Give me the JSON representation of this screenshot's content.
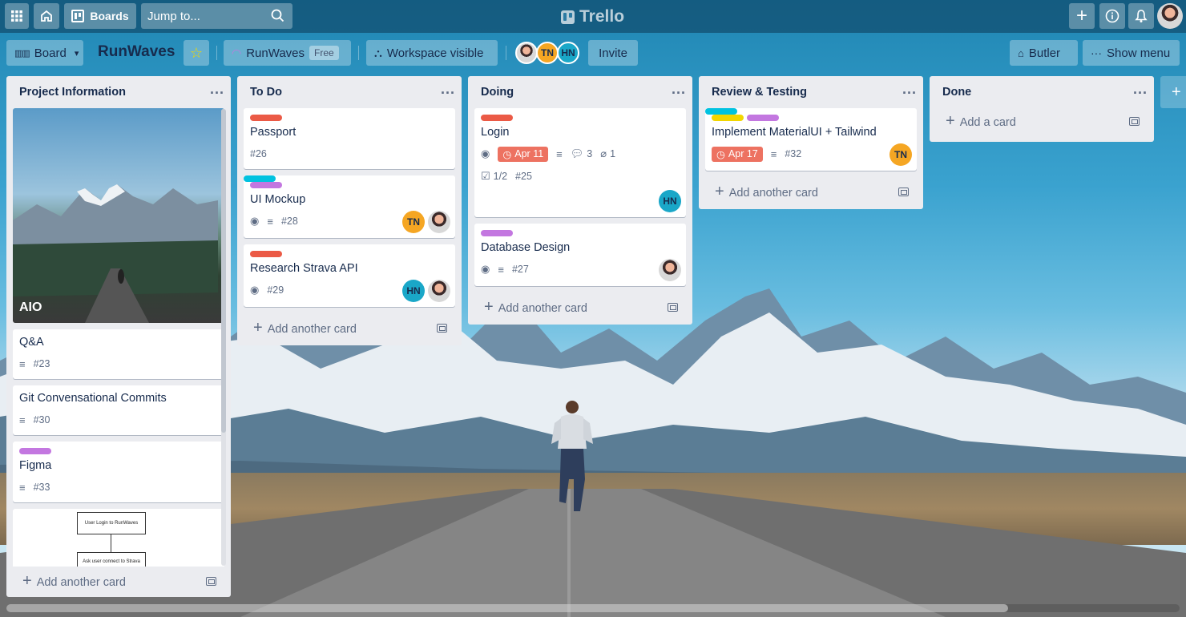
{
  "header": {
    "boards_label": "Boards",
    "search_placeholder": "Jump to...",
    "logo_text": "Trello"
  },
  "boardbar": {
    "view_label": "Board",
    "board_title": "RunWaves",
    "workspace_name": "RunWaves",
    "workspace_plan": "Free",
    "visibility_label": "Workspace visible",
    "members": [
      "TN",
      "HN"
    ],
    "invite_label": "Invite",
    "butler_label": "Butler",
    "show_menu_label": "Show menu"
  },
  "colors": {
    "label_red": "#eb5a46",
    "label_purple": "#c377e0",
    "label_sky": "#00c2e0",
    "label_yellow": "#f2d600",
    "avatar_tn": "#f5a623",
    "avatar_hn": "#1aa7c8"
  },
  "lists": [
    {
      "title": "Project Information",
      "cover_card": {
        "title": "AIO"
      },
      "cards": [
        {
          "title": "Q&A",
          "number": "#23"
        },
        {
          "title": "Git Convensational Commits",
          "number": "#30"
        },
        {
          "title": "Figma",
          "number": "#33"
        }
      ],
      "diagram": {
        "box1": "User Login to RunWaves",
        "box2": "Ask user connect to Strava"
      },
      "add_label": "Add another card"
    },
    {
      "title": "To Do",
      "cards": [
        {
          "title": "Passport",
          "number": "#26"
        },
        {
          "title": "UI Mockup",
          "number": "#28",
          "members": [
            "TN"
          ]
        },
        {
          "title": "Research Strava API",
          "number": "#29",
          "members": [
            "HN"
          ]
        }
      ],
      "add_label": "Add another card"
    },
    {
      "title": "Doing",
      "cards": [
        {
          "title": "Login",
          "due": "Apr 11",
          "comments": "3",
          "attachments": "1",
          "checklist": "1/2",
          "number": "#25",
          "members": [
            "HN"
          ]
        },
        {
          "title": "Database Design",
          "number": "#27"
        }
      ],
      "add_label": "Add another card"
    },
    {
      "title": "Review & Testing",
      "cards": [
        {
          "title": "Implement MaterialUI + Tailwind",
          "due": "Apr 17",
          "number": "#32",
          "members": [
            "TN"
          ]
        }
      ],
      "add_label": "Add another card"
    },
    {
      "title": "Done",
      "cards": [],
      "add_label": "Add a card"
    }
  ]
}
